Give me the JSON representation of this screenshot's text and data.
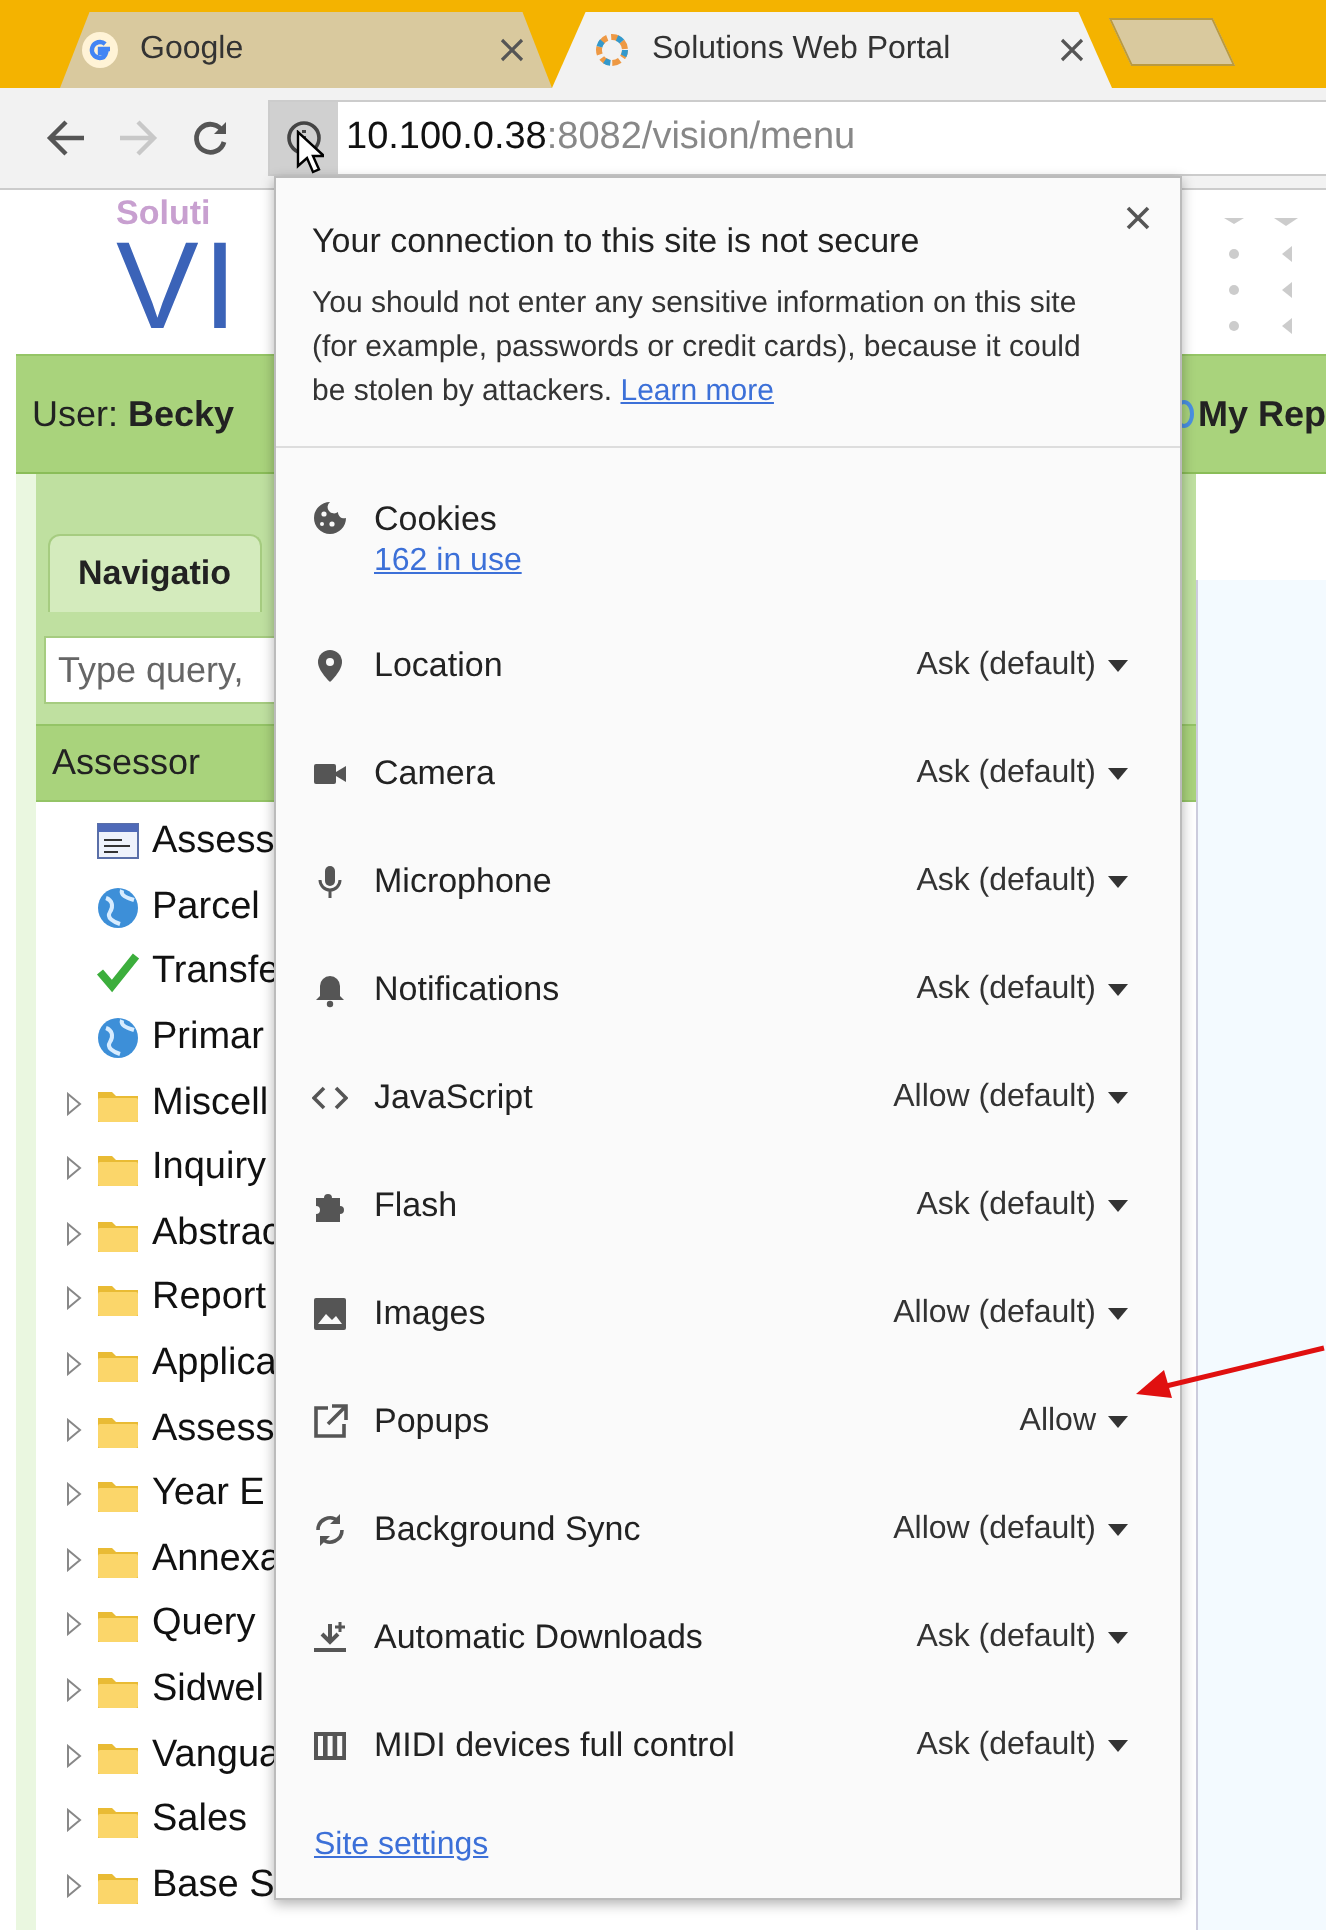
{
  "browser_tabs": [
    {
      "title": "Google",
      "selected": false
    },
    {
      "title": "Solutions Web Portal",
      "selected": true
    }
  ],
  "toolbar": {
    "back_disabled": false,
    "forward_disabled": true
  },
  "address": {
    "host": "10.100.0.38",
    "path": ":8082/vision/menu"
  },
  "logo": {
    "small": "Soluti",
    "large": "VI"
  },
  "user_bar": {
    "user": "User: **Becky**",
    "reports": "My Rep"
  },
  "navigation": {
    "tab": "Navigatio",
    "search": {
      "placeholder": "Type query, "
    },
    "header": "Assessor",
    "tree": [
      {
        "kind": "form",
        "label": "Assess"
      },
      {
        "kind": "globe",
        "label": "Parcel"
      },
      {
        "kind": "check",
        "label": "Transfe"
      },
      {
        "kind": "globe",
        "label": "Primar"
      },
      {
        "kind": "folder",
        "label": "Miscell",
        "expanded": false
      },
      {
        "kind": "folder",
        "label": "Inquiry",
        "expanded": false
      },
      {
        "kind": "folder",
        "label": "Abstrac",
        "expanded": false
      },
      {
        "kind": "folder",
        "label": "Report",
        "expanded": false
      },
      {
        "kind": "folder",
        "label": "Applica",
        "expanded": false
      },
      {
        "kind": "folder",
        "label": "Assess",
        "expanded": false
      },
      {
        "kind": "folder",
        "label": "Year E",
        "expanded": false
      },
      {
        "kind": "folder",
        "label": "Annexa",
        "expanded": false
      },
      {
        "kind": "folder",
        "label": "Query",
        "expanded": false
      },
      {
        "kind": "folder",
        "label": "Sidwel",
        "expanded": false
      },
      {
        "kind": "folder",
        "label": "Vangua",
        "expanded": false
      },
      {
        "kind": "folder",
        "label": "Sales",
        "expanded": false
      },
      {
        "kind": "folder",
        "label": "Base S",
        "expanded": false
      }
    ]
  },
  "site_info_popup": {
    "title": "Your connection to this site is not secure",
    "message": "You should not enter any sensitive information on this site (for example, passwords or credit cards), because it could be stolen by attackers.",
    "learn_more": "Learn more",
    "cookies": {
      "label": "Cookies",
      "link": "162 in use"
    },
    "permissions": [
      {
        "label": "Location",
        "value": "Ask (default)"
      },
      {
        "label": "Camera",
        "value": "Ask (default)"
      },
      {
        "label": "Microphone",
        "value": "Ask (default)"
      },
      {
        "label": "Notifications",
        "value": "Ask (default)"
      },
      {
        "label": "JavaScript",
        "value": "Allow (default)"
      },
      {
        "label": "Flash",
        "value": "Ask (default)"
      },
      {
        "label": "Images",
        "value": "Allow (default)"
      },
      {
        "label": "Popups",
        "value": "Allow"
      },
      {
        "label": "Background Sync",
        "value": "Allow (default)"
      },
      {
        "label": "Automatic Downloads",
        "value": "Ask (default)"
      },
      {
        "label": "MIDI devices full control",
        "value": "Ask (default)"
      }
    ],
    "footer_link": "Site settings"
  }
}
